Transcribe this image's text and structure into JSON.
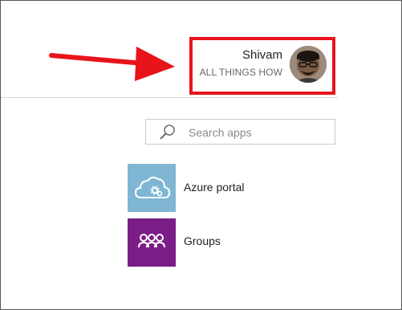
{
  "user": {
    "name": "Shivam",
    "org": "ALL THINGS HOW",
    "avatar_icon": "avatar-photo"
  },
  "search": {
    "placeholder": "Search apps",
    "icon": "search-icon"
  },
  "apps": [
    {
      "label": "Azure portal",
      "icon": "cloud-gear-icon",
      "tile_color": "#7fb6d3"
    },
    {
      "label": "Groups",
      "icon": "people-group-icon",
      "tile_color": "#7a1d86"
    }
  ],
  "colors": {
    "highlight": "#e8141c",
    "arrow": "#e8141c"
  }
}
